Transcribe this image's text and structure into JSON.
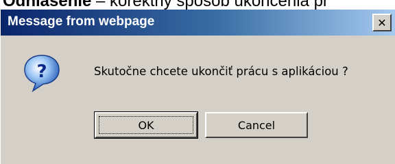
{
  "background": {
    "text_bold": "Odhlásenie",
    "text_rest": " – korektný spôsob ukončenia pr"
  },
  "dialog": {
    "title": "Message from webpage",
    "close_glyph": "✕",
    "icon": "question-icon",
    "message": "Skutočne chcete ukončiť prácu s aplikáciou ?",
    "ok_label": "OK",
    "cancel_label": "Cancel"
  },
  "colors": {
    "dialog_bg": "#d4d0c8",
    "titlebar_start": "#0a246a",
    "titlebar_end": "#a6caf0"
  }
}
